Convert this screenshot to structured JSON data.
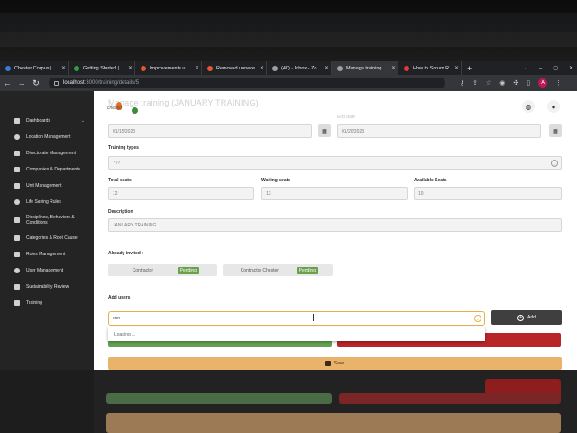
{
  "browser": {
    "tabs": [
      {
        "title": "Chester Corpus |",
        "color": "#3a7bd5",
        "active": false
      },
      {
        "title": "Getting Started |",
        "color": "#2f9e44",
        "active": false
      },
      {
        "title": "Improvements u",
        "color": "#e4572e",
        "active": false
      },
      {
        "title": "Removed unnece",
        "color": "#e4572e",
        "active": false
      },
      {
        "title": "(40) - Inbox - Zo",
        "color": "#9e9e9e",
        "active": false
      },
      {
        "title": "Manage training",
        "color": "#9e9e9e",
        "active": true
      },
      {
        "title": "How to Scrum R",
        "color": "#e53935",
        "active": false
      }
    ],
    "new_tab": "+",
    "window_controls": [
      "⌄",
      "–",
      "▢",
      "✕"
    ],
    "url_host": "localhost",
    "url_path": ":3000/training/details/5",
    "avatar_letter": "A"
  },
  "sidebar": {
    "items": [
      {
        "label": "Dashboards",
        "chevron": "⌄"
      },
      {
        "label": "Location Management"
      },
      {
        "label": "Directorate Management"
      },
      {
        "label": "Companies & Departments"
      },
      {
        "label": "Unit Management"
      },
      {
        "label": "Life Saving Rules"
      },
      {
        "label": "Disciplines, Behaviors & Conditions"
      },
      {
        "label": "Categories & Root Cause"
      },
      {
        "label": "Roles Management"
      },
      {
        "label": "User Management"
      },
      {
        "label": "Sustainability Review"
      },
      {
        "label": "Training"
      }
    ]
  },
  "page": {
    "ghost_title": "Manage training (JANUARY TRAINING)",
    "logo_text": "chester"
  },
  "form": {
    "start_date": "01/15/2023",
    "end_date": "01/20/2023",
    "end_date_ghost_label": "End date",
    "training_types_label": "Training types",
    "training_types_value": "???",
    "total_seats_label": "Total seats",
    "total_seats": "12",
    "waiting_seats_label": "Waiting seats",
    "waiting_seats": "13",
    "available_seats_label": "Available Seats",
    "available_seats": "10",
    "description_label": "Description",
    "description": "JANUARY TRAINING",
    "already_invited_label": "Already invited :",
    "invited": [
      {
        "name": "Contractor",
        "status": "Pending"
      },
      {
        "name": "Contractor Chester",
        "status": "Pending"
      }
    ],
    "add_users_label": "Add users",
    "search_value": "con",
    "add_button": "Add",
    "dropdown_loading": "Loading ...",
    "save_button": "Save"
  },
  "colors": {
    "accent_orange": "#eab36c",
    "pending_green": "#6a9f4e",
    "confirm_green": "#63a152",
    "danger_red": "#b8262a"
  }
}
